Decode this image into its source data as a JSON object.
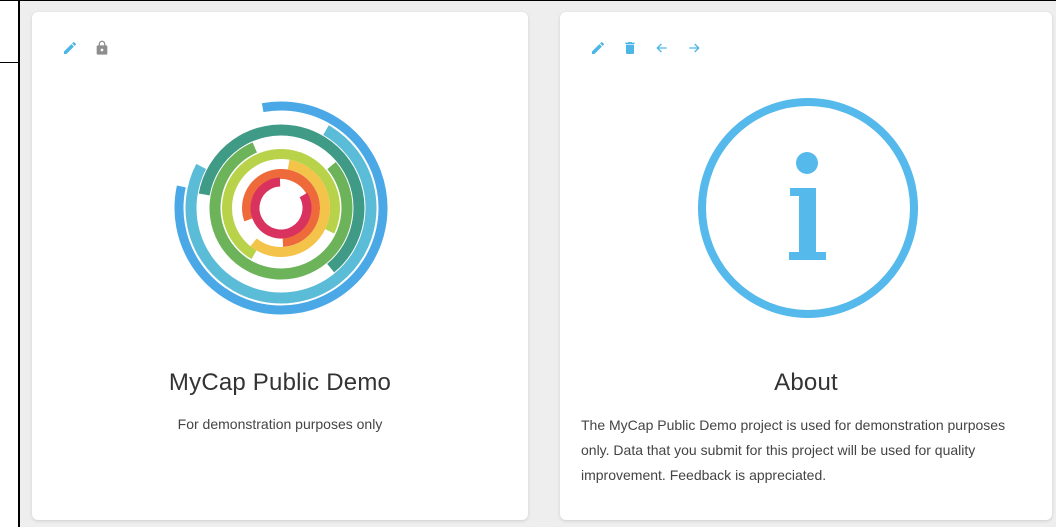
{
  "colors": {
    "accent": "#4db6e8",
    "lock": "#8e8e8e",
    "background": "#eeeeee"
  },
  "project_card": {
    "title": "MyCap Public Demo",
    "subtitle": "For demonstration purposes only",
    "toolbar_icons": [
      "edit-icon",
      "lock-icon"
    ]
  },
  "about_card": {
    "title": "About",
    "body": "The MyCap Public Demo project is used for demonstration purposes only. Data that you submit for this project will be used for quality improvement. Feedback is appreciated.",
    "toolbar_icons": [
      "edit-icon",
      "delete-icon",
      "arrow-left-icon",
      "arrow-right-icon"
    ]
  }
}
